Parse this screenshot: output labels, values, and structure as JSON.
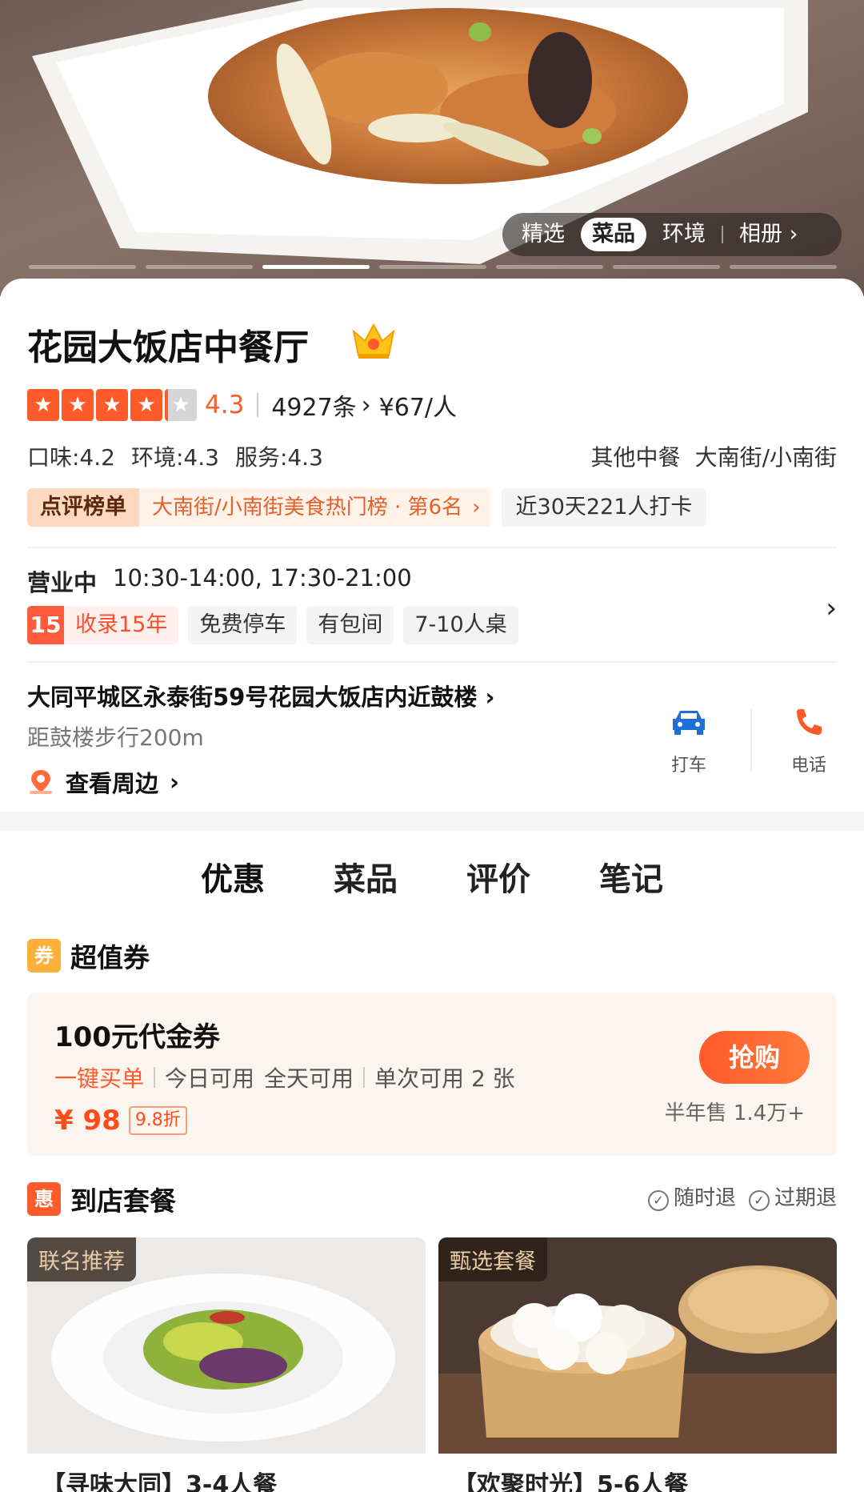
{
  "hero": {
    "tabs": [
      "精选",
      "菜品",
      "环境",
      "相册"
    ],
    "active_tab": "菜品",
    "more_icon": "chevron-right-icon",
    "slide_count": 7,
    "active_slide": 3
  },
  "restaurant": {
    "name": "花园大饭店中餐厅",
    "badge_icon": "crown-icon",
    "rating": "4.3",
    "rating_value": 4.3,
    "review_count": "4927条",
    "price_per_person": "¥67/人",
    "scores": [
      "口味:4.2",
      "环境:4.3",
      "服务:4.3"
    ],
    "cuisine": "其他中餐",
    "area": "大南街/小南街",
    "rank_tag": "点评榜单",
    "rank_text": "大南街/小南街美食热门榜 · 第6名",
    "checkin": "近30天221人打卡"
  },
  "hours": {
    "status": "营业中",
    "time": "10:30-14:00, 17:30-21:00",
    "years_num": "15",
    "years_text": "收录15年",
    "features": [
      "免费停车",
      "有包间",
      "7-10人桌"
    ]
  },
  "location": {
    "address": "大同平城区永泰街59号花园大饭店内近鼓楼",
    "distance": "距鼓楼步行200m",
    "nearby": "查看周边",
    "taxi_label": "打车",
    "phone_label": "电话"
  },
  "tabs": [
    "优惠",
    "菜品",
    "评价",
    "笔记"
  ],
  "active_tab": "优惠",
  "voucher_section": {
    "badge": "券",
    "title": "超值券",
    "name": "100元代金券",
    "quick_pay": "一键买单",
    "availability_day": "今日可用",
    "availability_time": "全天可用",
    "per_use": "单次可用 2 张",
    "price": "¥ 98",
    "discount": "9.8折",
    "buy_label": "抢购",
    "sold": "半年售 1.4万+"
  },
  "package_section": {
    "badge": "惠",
    "title": "到店套餐",
    "refund_anytime": "随时退",
    "refund_expired": "过期退",
    "items": [
      {
        "label": "联名推荐",
        "name": "【寻味大同】3-4人餐"
      },
      {
        "label": "甄选套餐",
        "name": "【欢聚时光】5-6人餐"
      }
    ]
  },
  "colors": {
    "accent": "#ff5a2a",
    "rank_bg": "#fff2e9",
    "voucher_bg": "#fcf4ef",
    "taxi_blue": "#1f6fd6"
  }
}
